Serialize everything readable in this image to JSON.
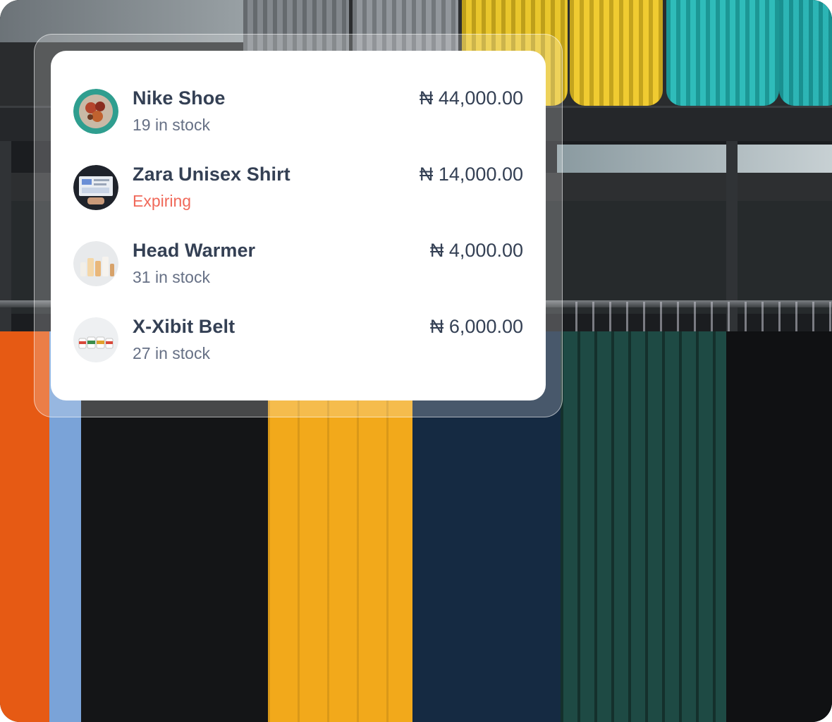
{
  "products": [
    {
      "name": "Nike Shoe",
      "status": "19 in stock",
      "status_type": "normal",
      "price": "₦ 44,000.00",
      "thumb_icon": "food-plate-icon"
    },
    {
      "name": "Zara Unisex Shirt",
      "status": "Expiring",
      "status_type": "expiring",
      "price": "₦ 14,000.00",
      "thumb_icon": "laptop-dashboard-icon"
    },
    {
      "name": "Head Warmer",
      "status": "31 in stock",
      "status_type": "normal",
      "price": "₦ 4,000.00",
      "thumb_icon": "cosmetics-bottles-icon"
    },
    {
      "name": "X-Xibit Belt",
      "status": "27 in stock",
      "status_type": "normal",
      "price": "₦ 6,000.00",
      "thumb_icon": "jars-icon"
    }
  ],
  "colors": {
    "text_primary": "#344054",
    "text_secondary": "#667085",
    "expiring": "#f0695a",
    "card_bg": "#ffffff"
  }
}
